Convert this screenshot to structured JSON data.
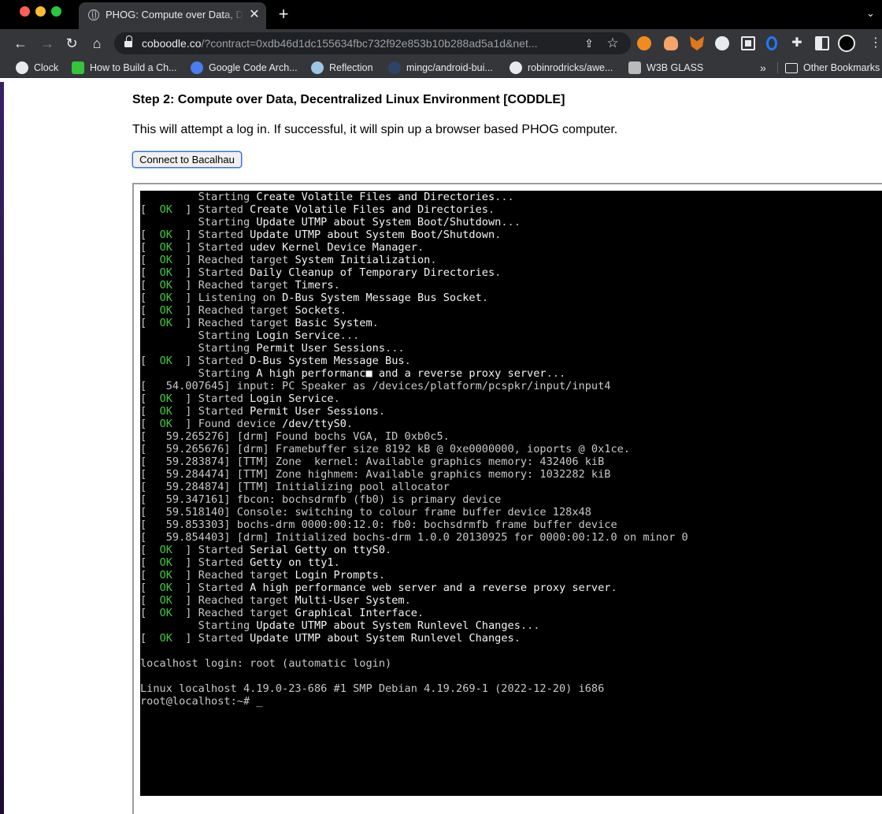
{
  "browser": {
    "tab": {
      "title": "PHOG: Compute over Data, Decentralized Linux Environment",
      "close": "✕"
    },
    "new_tab": "+",
    "tab_menu": "⌄",
    "nav": {
      "back": "←",
      "forward": "→",
      "reload": "↻",
      "home": "⌂"
    },
    "address": {
      "domain": "coboodle.co",
      "path": "/?contract=0xdb46d1dc155634fbc732f92e853b10b288ad5a1d&net..."
    },
    "share": "⇪",
    "star": "☆",
    "toolbar_menu": "⋮",
    "extensions": [
      "metamask-fox",
      "weather",
      "brave-fox",
      "spaceship",
      "screen-capture",
      "opera",
      "puzzle",
      "sidebar"
    ],
    "ext_puzzle_glyph": "✚"
  },
  "bookmarks": {
    "items": [
      {
        "label": "Clock"
      },
      {
        "label": "How to Build a Ch..."
      },
      {
        "label": "Google Code Arch..."
      },
      {
        "label": "Reflection"
      },
      {
        "label": "mingc/android-bui..."
      },
      {
        "label": "robinrodricks/awe..."
      },
      {
        "label": "W3B GLASS"
      }
    ],
    "more": "»",
    "other": "Other Bookmarks"
  },
  "page": {
    "heading": "Step 2: Compute over Data, Decentralized Linux Environment [CODDLE]",
    "description": "This will attempt a log in. If successful, it will spin up a browser based PHOG computer.",
    "connect_button": "Connect to Bacalhau"
  },
  "terminal": {
    "lines": [
      {
        "status": "",
        "pre": "         Starting ",
        "hl": "Create Volatile Files and Directories",
        "post": "..."
      },
      {
        "status": "OK",
        "pre": "Started ",
        "hl": "Create Volatile Files and Directories",
        "post": "."
      },
      {
        "status": "",
        "pre": "         Starting ",
        "hl": "Update UTMP about System Boot/Shutdown",
        "post": "..."
      },
      {
        "status": "OK",
        "pre": "Started ",
        "hl": "Update UTMP about System Boot/Shutdown",
        "post": "."
      },
      {
        "status": "OK",
        "pre": "Started ",
        "hl": "udev Kernel Device Manager",
        "post": "."
      },
      {
        "status": "OK",
        "pre": "Reached target ",
        "hl": "System Initialization",
        "post": "."
      },
      {
        "status": "OK",
        "pre": "Started ",
        "hl": "Daily Cleanup of Temporary Directories",
        "post": "."
      },
      {
        "status": "OK",
        "pre": "Reached target ",
        "hl": "Timers",
        "post": "."
      },
      {
        "status": "OK",
        "pre": "Listening on ",
        "hl": "D-Bus System Message Bus Socket",
        "post": "."
      },
      {
        "status": "OK",
        "pre": "Reached target ",
        "hl": "Sockets",
        "post": "."
      },
      {
        "status": "OK",
        "pre": "Reached target ",
        "hl": "Basic System",
        "post": "."
      },
      {
        "status": "",
        "pre": "         Starting ",
        "hl": "Login Service",
        "post": "..."
      },
      {
        "status": "",
        "pre": "         Starting ",
        "hl": "Permit User Sessions",
        "post": "..."
      },
      {
        "status": "OK",
        "pre": "Started ",
        "hl": "D-Bus System Message Bus",
        "post": "."
      },
      {
        "status": "",
        "pre": "         Starting ",
        "hl": "A high performanc■ and a reverse proxy server",
        "post": "..."
      },
      {
        "status": "",
        "pre": "[   54.007645] input: PC Speaker as /devices/platform/pcspkr/input/input4",
        "hl": "",
        "post": ""
      },
      {
        "status": "OK",
        "pre": "Started ",
        "hl": "Login Service",
        "post": "."
      },
      {
        "status": "OK",
        "pre": "Started ",
        "hl": "Permit User Sessions",
        "post": "."
      },
      {
        "status": "OK",
        "pre": "Found device ",
        "hl": "/dev/ttyS0",
        "post": "."
      },
      {
        "status": "",
        "pre": "[   59.265276] [drm] Found bochs VGA, ID 0xb0c5.",
        "hl": "",
        "post": ""
      },
      {
        "status": "",
        "pre": "[   59.265676] [drm] Framebuffer size 8192 kB @ 0xe0000000, ioports @ 0x1ce.",
        "hl": "",
        "post": ""
      },
      {
        "status": "",
        "pre": "[   59.283874] [TTM] Zone  kernel: Available graphics memory: 432406 kiB",
        "hl": "",
        "post": ""
      },
      {
        "status": "",
        "pre": "[   59.284474] [TTM] Zone highmem: Available graphics memory: 1032282 kiB",
        "hl": "",
        "post": ""
      },
      {
        "status": "",
        "pre": "[   59.284874] [TTM] Initializing pool allocator",
        "hl": "",
        "post": ""
      },
      {
        "status": "",
        "pre": "[   59.347161] fbcon: bochsdrmfb (fb0) is primary device",
        "hl": "",
        "post": ""
      },
      {
        "status": "",
        "pre": "[   59.518140] Console: switching to colour frame buffer device 128x48",
        "hl": "",
        "post": ""
      },
      {
        "status": "",
        "pre": "[   59.853303] bochs-drm 0000:00:12.0: fb0: bochsdrmfb frame buffer device",
        "hl": "",
        "post": ""
      },
      {
        "status": "",
        "pre": "[   59.854403] [drm] Initialized bochs-drm 1.0.0 20130925 for 0000:00:12.0 on minor 0",
        "hl": "",
        "post": ""
      },
      {
        "status": "OK",
        "pre": "Started ",
        "hl": "Serial Getty on ttyS0",
        "post": "."
      },
      {
        "status": "OK",
        "pre": "Started ",
        "hl": "Getty on tty1",
        "post": "."
      },
      {
        "status": "OK",
        "pre": "Reached target ",
        "hl": "Login Prompts",
        "post": "."
      },
      {
        "status": "OK",
        "pre": "Started ",
        "hl": "A high performance web server and a reverse proxy server",
        "post": "."
      },
      {
        "status": "OK",
        "pre": "Reached target ",
        "hl": "Multi-User System",
        "post": "."
      },
      {
        "status": "OK",
        "pre": "Reached target ",
        "hl": "Graphical Interface",
        "post": "."
      },
      {
        "status": "",
        "pre": "         Starting ",
        "hl": "Update UTMP about System Runlevel Changes",
        "post": "..."
      },
      {
        "status": "OK",
        "pre": "Started ",
        "hl": "Update UTMP about System Runlevel Changes",
        "post": "."
      },
      {
        "status": "",
        "pre": "",
        "hl": "",
        "post": ""
      },
      {
        "status": "",
        "pre": "localhost login: root (automatic login)",
        "hl": "",
        "post": ""
      },
      {
        "status": "",
        "pre": "",
        "hl": "",
        "post": ""
      },
      {
        "status": "",
        "pre": "Linux localhost 4.19.0-23-686 #1 SMP Debian 4.19.269-1 (2022-12-20) i686",
        "hl": "",
        "post": ""
      },
      {
        "status": "",
        "pre": "root@localhost:~# ",
        "hl": "",
        "post": "_"
      }
    ]
  },
  "colors": {
    "terminal_bg": "#000000",
    "terminal_text": "#c8c8c8",
    "ok": "#3ec93e",
    "chrome_dark": "#35363a"
  }
}
